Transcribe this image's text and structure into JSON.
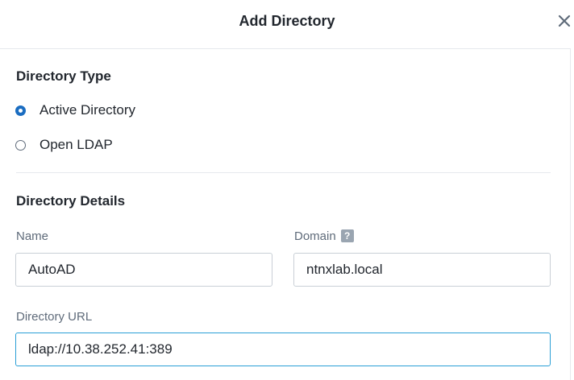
{
  "dialog": {
    "title": "Add Directory",
    "close_icon": "close-icon"
  },
  "directory_type": {
    "title": "Directory Type",
    "options": [
      {
        "label": "Active Directory",
        "selected": true
      },
      {
        "label": "Open LDAP",
        "selected": false
      }
    ]
  },
  "directory_details": {
    "title": "Directory Details",
    "name": {
      "label": "Name",
      "value": "AutoAD"
    },
    "domain": {
      "label": "Domain",
      "help_icon": "help-icon",
      "help_glyph": "?",
      "value": "ntnxlab.local"
    },
    "url": {
      "label": "Directory URL",
      "value": "ldap://10.38.252.41:389"
    }
  },
  "colors": {
    "accent": "#1b6dc1",
    "focus_border": "#2a9fd6",
    "text": "#22272e",
    "muted": "#5f6b7a"
  }
}
